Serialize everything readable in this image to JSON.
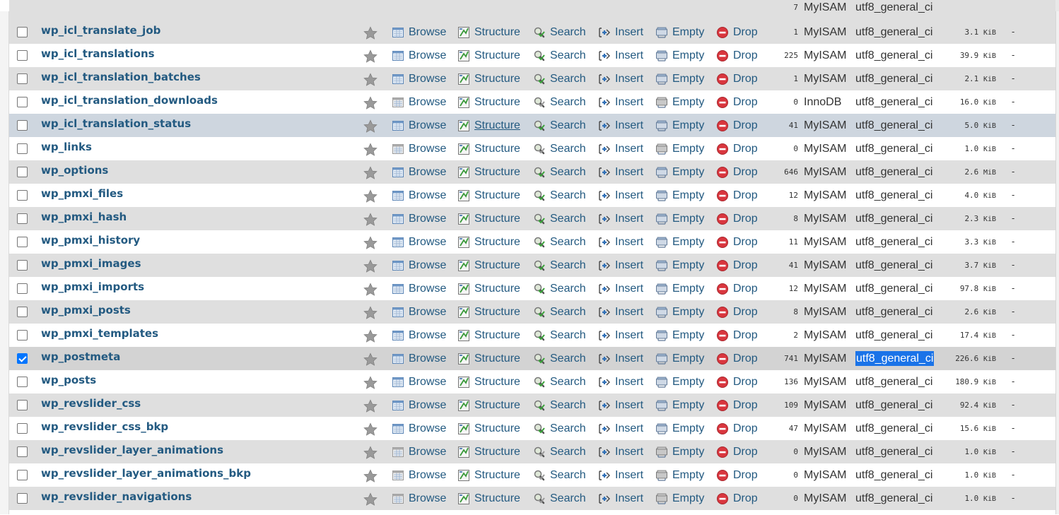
{
  "actions": {
    "browse": "Browse",
    "structure": "Structure",
    "search": "Search",
    "insert": "Insert",
    "empty": "Empty",
    "drop": "Drop"
  },
  "colors": {
    "row_even": "#dfdfdf",
    "row_hover": "#ced6df",
    "row_marked": "#d3d3d3",
    "link": "#235a81",
    "selection": "#1a73e8",
    "drop_icon": "#d9363e"
  },
  "partial_row": {
    "count": "7",
    "engine": "MyISAM",
    "collation": "utf8_general_ci"
  },
  "tables": [
    {
      "name": "wp_icl_translate_job",
      "rows": "1",
      "engine": "MyISAM",
      "collation": "utf8_general_ci",
      "size": "3.1",
      "unit": "KiB",
      "overhead": "-",
      "checked": false,
      "populated": true
    },
    {
      "name": "wp_icl_translations",
      "rows": "225",
      "engine": "MyISAM",
      "collation": "utf8_general_ci",
      "size": "39.9",
      "unit": "KiB",
      "overhead": "-",
      "checked": false,
      "populated": true
    },
    {
      "name": "wp_icl_translation_batches",
      "rows": "1",
      "engine": "MyISAM",
      "collation": "utf8_general_ci",
      "size": "2.1",
      "unit": "KiB",
      "overhead": "-",
      "checked": false,
      "populated": true
    },
    {
      "name": "wp_icl_translation_downloads",
      "rows": "0",
      "engine": "InnoDB",
      "collation": "utf8_general_ci",
      "size": "16.0",
      "unit": "KiB",
      "overhead": "-",
      "checked": false,
      "populated": false
    },
    {
      "name": "wp_icl_translation_status",
      "rows": "41",
      "engine": "MyISAM",
      "collation": "utf8_general_ci",
      "size": "5.0",
      "unit": "KiB",
      "overhead": "-",
      "checked": false,
      "populated": true,
      "hover": true
    },
    {
      "name": "wp_links",
      "rows": "0",
      "engine": "MyISAM",
      "collation": "utf8_general_ci",
      "size": "1.0",
      "unit": "KiB",
      "overhead": "-",
      "checked": false,
      "populated": false
    },
    {
      "name": "wp_options",
      "rows": "646",
      "engine": "MyISAM",
      "collation": "utf8_general_ci",
      "size": "2.6",
      "unit": "MiB",
      "overhead": "-",
      "checked": false,
      "populated": true
    },
    {
      "name": "wp_pmxi_files",
      "rows": "12",
      "engine": "MyISAM",
      "collation": "utf8_general_ci",
      "size": "4.0",
      "unit": "KiB",
      "overhead": "-",
      "checked": false,
      "populated": true
    },
    {
      "name": "wp_pmxi_hash",
      "rows": "8",
      "engine": "MyISAM",
      "collation": "utf8_general_ci",
      "size": "2.3",
      "unit": "KiB",
      "overhead": "-",
      "checked": false,
      "populated": true
    },
    {
      "name": "wp_pmxi_history",
      "rows": "11",
      "engine": "MyISAM",
      "collation": "utf8_general_ci",
      "size": "3.3",
      "unit": "KiB",
      "overhead": "-",
      "checked": false,
      "populated": true
    },
    {
      "name": "wp_pmxi_images",
      "rows": "41",
      "engine": "MyISAM",
      "collation": "utf8_general_ci",
      "size": "3.7",
      "unit": "KiB",
      "overhead": "-",
      "checked": false,
      "populated": true
    },
    {
      "name": "wp_pmxi_imports",
      "rows": "12",
      "engine": "MyISAM",
      "collation": "utf8_general_ci",
      "size": "97.8",
      "unit": "KiB",
      "overhead": "-",
      "checked": false,
      "populated": true
    },
    {
      "name": "wp_pmxi_posts",
      "rows": "8",
      "engine": "MyISAM",
      "collation": "utf8_general_ci",
      "size": "2.6",
      "unit": "KiB",
      "overhead": "-",
      "checked": false,
      "populated": true
    },
    {
      "name": "wp_pmxi_templates",
      "rows": "2",
      "engine": "MyISAM",
      "collation": "utf8_general_ci",
      "size": "17.4",
      "unit": "KiB",
      "overhead": "-",
      "checked": false,
      "populated": true
    },
    {
      "name": "wp_postmeta",
      "rows": "741",
      "engine": "MyISAM",
      "collation": "utf8_general_ci",
      "size": "226.6",
      "unit": "KiB",
      "overhead": "-",
      "checked": true,
      "populated": true,
      "selected_collation": true
    },
    {
      "name": "wp_posts",
      "rows": "136",
      "engine": "MyISAM",
      "collation": "utf8_general_ci",
      "size": "180.9",
      "unit": "KiB",
      "overhead": "-",
      "checked": false,
      "populated": true
    },
    {
      "name": "wp_revslider_css",
      "rows": "109",
      "engine": "MyISAM",
      "collation": "utf8_general_ci",
      "size": "92.4",
      "unit": "KiB",
      "overhead": "-",
      "checked": false,
      "populated": true
    },
    {
      "name": "wp_revslider_css_bkp",
      "rows": "47",
      "engine": "MyISAM",
      "collation": "utf8_general_ci",
      "size": "15.6",
      "unit": "KiB",
      "overhead": "-",
      "checked": false,
      "populated": true
    },
    {
      "name": "wp_revslider_layer_animations",
      "rows": "0",
      "engine": "MyISAM",
      "collation": "utf8_general_ci",
      "size": "1.0",
      "unit": "KiB",
      "overhead": "-",
      "checked": false,
      "populated": false
    },
    {
      "name": "wp_revslider_layer_animations_bkp",
      "rows": "0",
      "engine": "MyISAM",
      "collation": "utf8_general_ci",
      "size": "1.0",
      "unit": "KiB",
      "overhead": "-",
      "checked": false,
      "populated": false
    },
    {
      "name": "wp_revslider_navigations",
      "rows": "0",
      "engine": "MyISAM",
      "collation": "utf8_general_ci",
      "size": "1.0",
      "unit": "KiB",
      "overhead": "-",
      "checked": false,
      "populated": false
    }
  ]
}
